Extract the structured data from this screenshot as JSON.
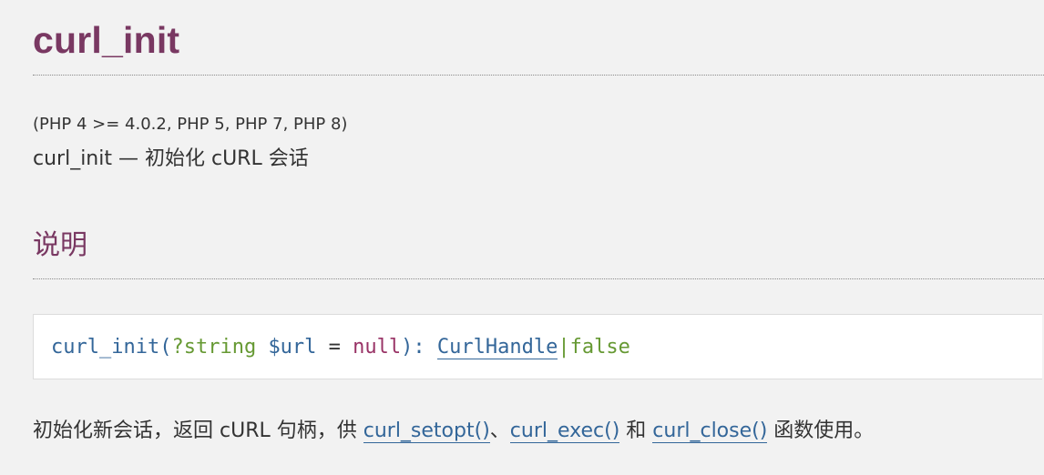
{
  "title": "curl_init",
  "versions": "(PHP 4 >= 4.0.2, PHP 5, PHP 7, PHP 8)",
  "refpurpose": "curl_init — 初始化 cURL 会话",
  "section_heading": "说明",
  "synopsis": {
    "function": "curl_init",
    "open_paren": "(",
    "param_type": "?string",
    "param_var": "$url",
    "equals": " = ",
    "default": "null",
    "close": "): ",
    "return_type_link": "CurlHandle",
    "pipe": "|",
    "return_type_alt": "false"
  },
  "description": {
    "prefix": "初始化新会话，返回 cURL 句柄，供 ",
    "link1": "curl_setopt()",
    "sep1": "、",
    "link2": "curl_exec()",
    "sep2": " 和 ",
    "link3": "curl_close()",
    "suffix": " 函数使用。"
  },
  "colors": {
    "heading": "#793862",
    "link": "#336699",
    "type": "#669933",
    "null": "#993366",
    "background": "#f2f2f2"
  }
}
